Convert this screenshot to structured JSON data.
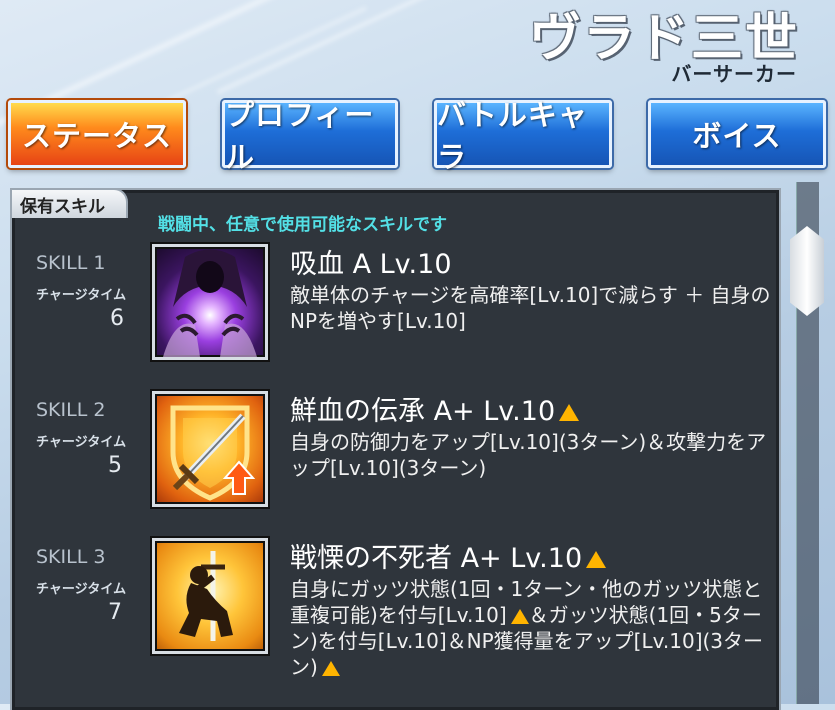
{
  "header": {
    "title": "ヴラド三世",
    "subtitle": "バーサーカー"
  },
  "tabs": [
    {
      "label": "ステータス",
      "active": true
    },
    {
      "label": "プロフィール",
      "active": false
    },
    {
      "label": "バトルキャラ",
      "active": false
    },
    {
      "label": "ボイス",
      "active": false
    }
  ],
  "panel": {
    "title": "保有スキル",
    "hint": "戦闘中、任意で使用可能なスキルです"
  },
  "skills": [
    {
      "label": "SKILL 1",
      "charge_label": "チャージタイム",
      "charge": "6",
      "name": "吸血 A Lv.10",
      "desc": "敵単体のチャージを高確率[Lv.10]で減らす ＋ 自身のNPを増やす[Lv.10]",
      "icon": "vampire-drain-icon"
    },
    {
      "label": "SKILL 2",
      "charge_label": "チャージタイム",
      "charge": "5",
      "name": "鮮血の伝承 A+ Lv.10",
      "desc": "自身の防御力をアップ[Lv.10](3ターン)＆攻撃力をアップ[Lv.10](3ターン)",
      "icon": "sword-shield-up-icon"
    },
    {
      "label": "SKILL 3",
      "charge_label": "チャージタイム",
      "charge": "7",
      "name": "戦慄の不死者 A+ Lv.10",
      "desc_parts": [
        "自身にガッツ状態(1回・1ターン・他のガッツ状態と重複可能)を付与[Lv.10]",
        "＆ガッツ状態(1回・5ターン)を付与[Lv.10]＆NP獲得量をアップ[Lv.10](3ターン)"
      ],
      "icon": "kneeling-knight-icon"
    }
  ],
  "colors": {
    "hint": "#53e0e6",
    "upgrade": "#ffb400",
    "active_tab": "#ff8a1c",
    "tab": "#1e6ed8"
  }
}
